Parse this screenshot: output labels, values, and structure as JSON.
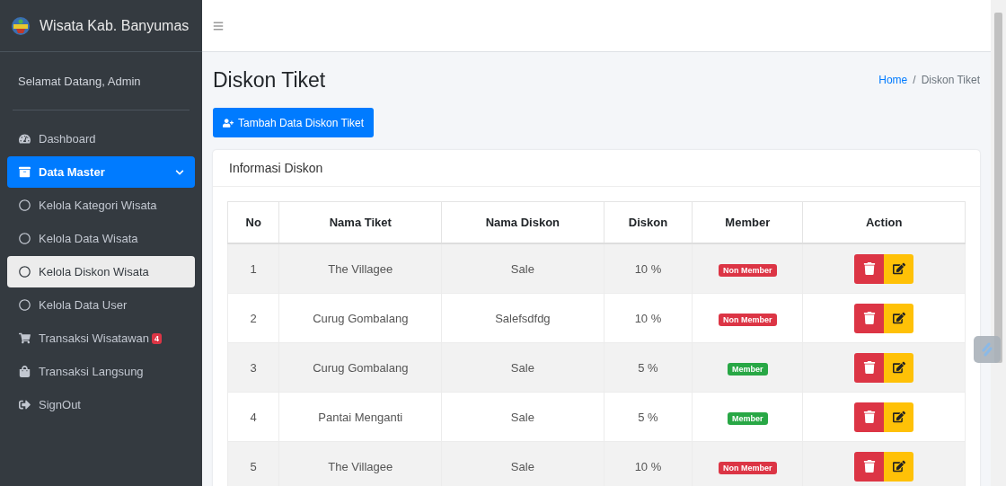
{
  "brand": {
    "title": "Wisata Kab. Banyumas"
  },
  "user": {
    "greeting": "Selamat Datang, Admin"
  },
  "sidebar": {
    "items": [
      {
        "label": "Dashboard",
        "selected": false
      },
      {
        "label": "Data Master",
        "selected": true,
        "expanded": true,
        "children": [
          {
            "label": "Kelola Kategori Wisata",
            "selected": false
          },
          {
            "label": "Kelola Data Wisata",
            "selected": false
          },
          {
            "label": "Kelola Diskon Wisata",
            "selected": true
          },
          {
            "label": "Kelola Data User",
            "selected": false
          }
        ]
      },
      {
        "label": "Transaksi Wisatawan",
        "selected": false,
        "badge": "4"
      },
      {
        "label": "Transaksi Langsung",
        "selected": false
      },
      {
        "label": "SignOut",
        "selected": false
      }
    ]
  },
  "page": {
    "title": "Diskon Tiket",
    "breadcrumb_separator": "/",
    "breadcrumb": [
      {
        "label": "Home",
        "link": true
      },
      {
        "label": "Diskon Tiket",
        "link": false
      }
    ],
    "add_button": "Tambah Data Diskon Tiket"
  },
  "card": {
    "title": "Informasi Diskon"
  },
  "table": {
    "columns": [
      "No",
      "Nama Tiket",
      "Nama Diskon",
      "Diskon",
      "Member",
      "Action"
    ],
    "rows": [
      {
        "no": "1",
        "ticket": "The Villagee",
        "discount_name": "Sale",
        "discount": "10 %",
        "member": false,
        "member_label": "Non Member"
      },
      {
        "no": "2",
        "ticket": "Curug Gombalang",
        "discount_name": "Salefsdfdg",
        "discount": "10 %",
        "member": false,
        "member_label": "Non Member"
      },
      {
        "no": "3",
        "ticket": "Curug Gombalang",
        "discount_name": "Sale",
        "discount": "5 %",
        "member": true,
        "member_label": "Member"
      },
      {
        "no": "4",
        "ticket": "Pantai Menganti",
        "discount_name": "Sale",
        "discount": "5 %",
        "member": true,
        "member_label": "Member"
      },
      {
        "no": "5",
        "ticket": "The Villagee",
        "discount_name": "Sale",
        "discount": "10 %",
        "member": false,
        "member_label": "Non Member"
      }
    ]
  }
}
